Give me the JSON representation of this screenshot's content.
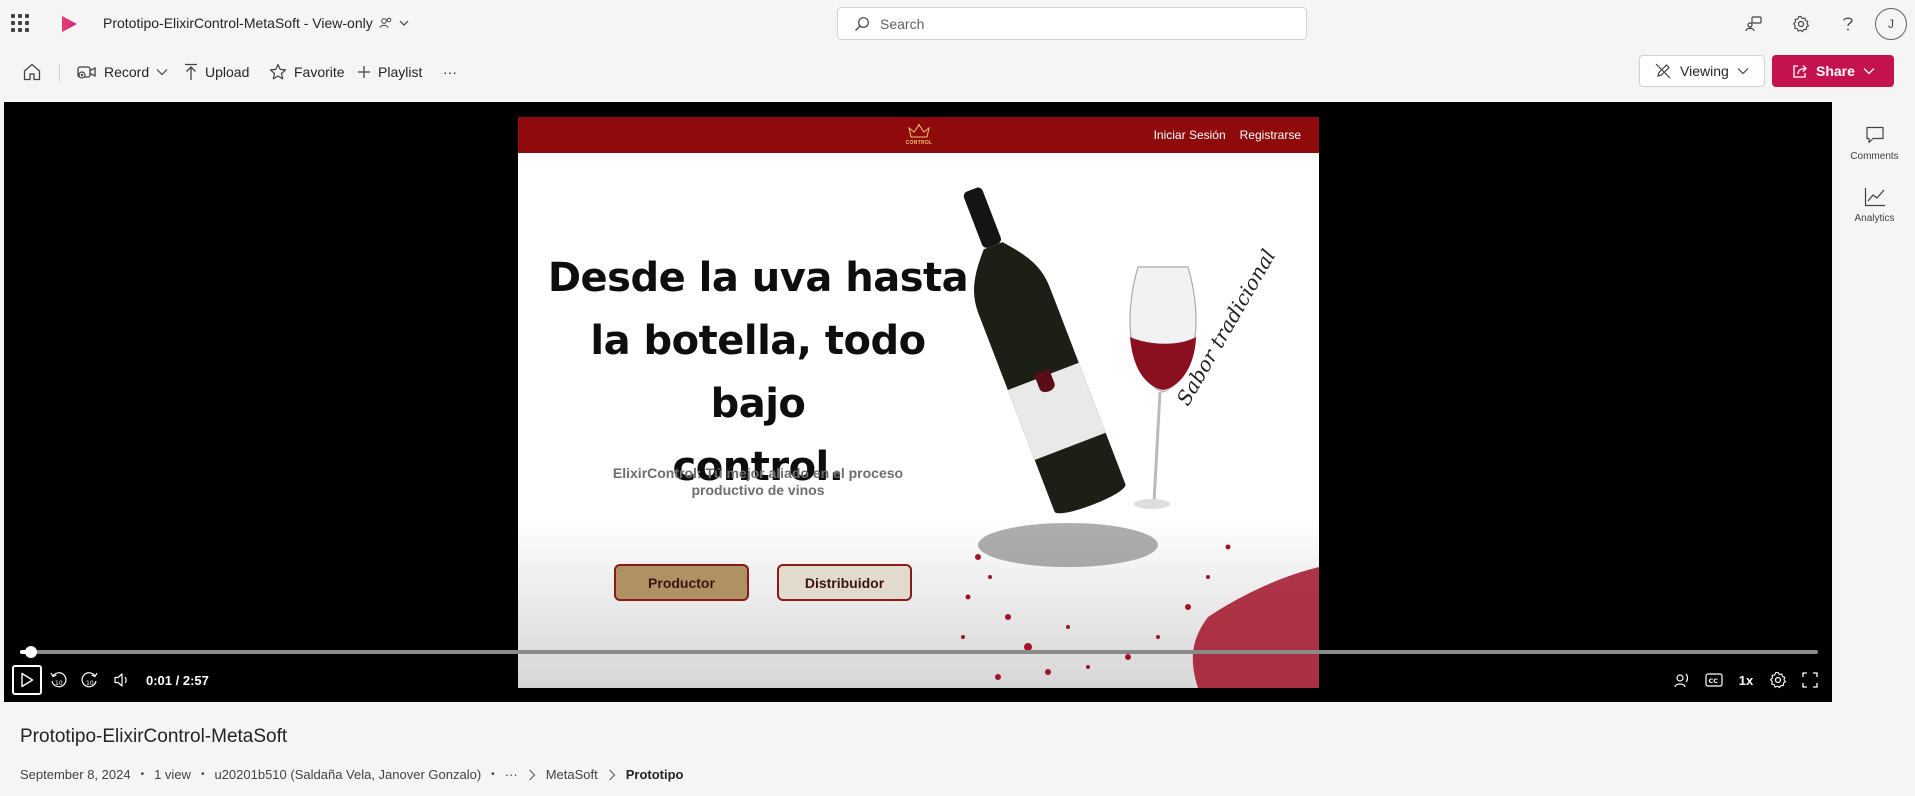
{
  "topbar": {
    "document_title": "Prototipo-ElixirControl-MetaSoft - View-only",
    "search_placeholder": "Search",
    "avatar_initial": "J",
    "icons": [
      "waffle-icon",
      "stream-logo-icon",
      "shared-people-icon",
      "chevron-down-icon",
      "search-icon",
      "feedback-icon",
      "settings-icon",
      "help-icon"
    ]
  },
  "commandbar": {
    "record_label": "Record",
    "upload_label": "Upload",
    "favorite_label": "Favorite",
    "playlist_label": "Playlist",
    "more_label": "···",
    "viewing_label": "Viewing",
    "share_label": "Share",
    "share_color": "#c4124f"
  },
  "video_frame": {
    "nav_login": "Iniciar Sesión",
    "nav_register": "Registrarse",
    "logo_text": "CONTROL",
    "headline_line1": "Desde la uva hasta",
    "headline_line2": "la botella, todo bajo",
    "headline_line3": "control.",
    "tagline_line1": "ElixirControl: Tú mejor aliado en el proceso",
    "tagline_line2": "productivo de vinos",
    "button_producer": "Productor",
    "button_distributor": "Distribuidor",
    "script_text": "Sabor tradicional",
    "nav_color": "#8e0a0b"
  },
  "player": {
    "current_time": "0:01",
    "duration": "2:57",
    "time_display": "0:01 / 2:57",
    "progress_fraction": 0.006,
    "speed_label": "1x"
  },
  "rail": {
    "comments_label": "Comments",
    "analytics_label": "Analytics"
  },
  "info": {
    "title": "Prototipo-ElixirControl-MetaSoft",
    "date": "September 8, 2024",
    "views": "1 view",
    "owner": "u20201b510 (Saldaña Vela, Janover Gonzalo)",
    "breadcrumb_more": "···",
    "breadcrumb_1": "MetaSoft",
    "breadcrumb_2": "Prototipo"
  }
}
